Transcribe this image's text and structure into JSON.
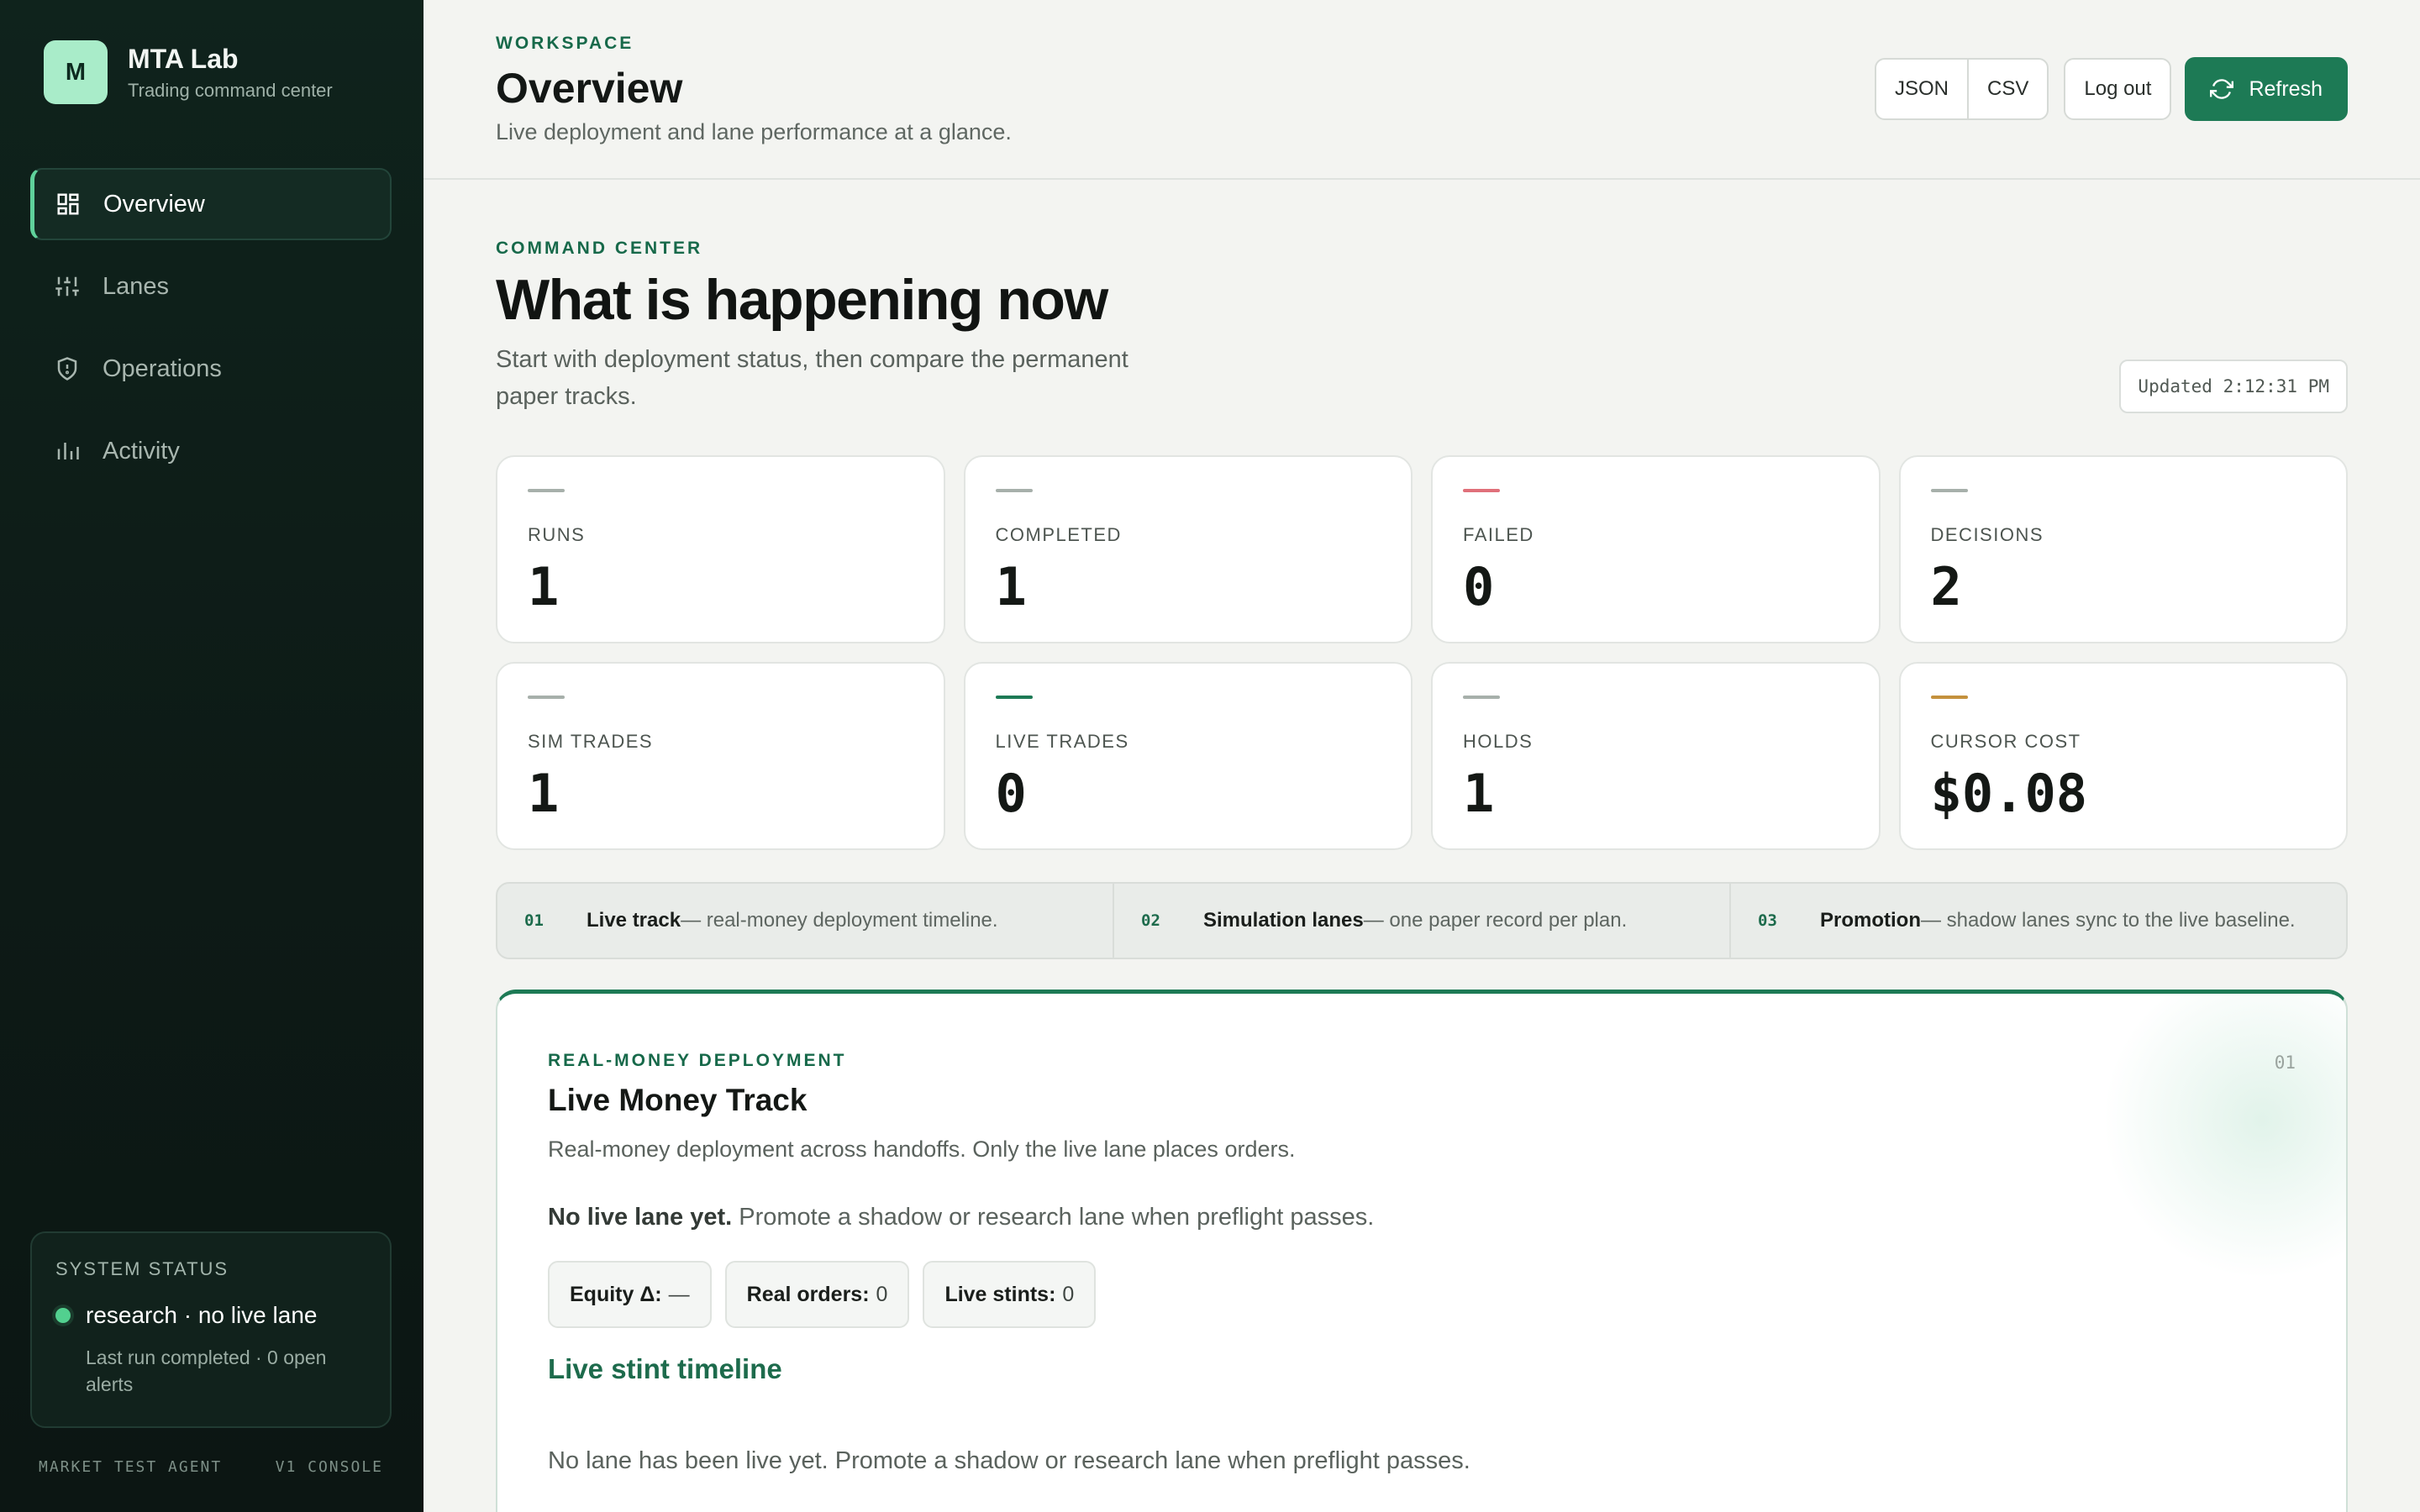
{
  "sidebar": {
    "brand": {
      "initial": "M",
      "name": "MTA Lab",
      "subtitle": "Trading command center"
    },
    "nav": [
      {
        "label": "Overview",
        "icon": "dashboard-icon",
        "active": true
      },
      {
        "label": "Lanes",
        "icon": "sliders-icon",
        "active": false
      },
      {
        "label": "Operations",
        "icon": "shield-icon",
        "active": false
      },
      {
        "label": "Activity",
        "icon": "bar-chart-icon",
        "active": false
      }
    ],
    "status": {
      "heading": "SYSTEM STATUS",
      "state": "research · no live lane",
      "detail": "Last run completed · 0 open alerts",
      "dot_color": "#52d08f"
    },
    "footer": {
      "left": "MARKET TEST AGENT",
      "right": "V1 CONSOLE"
    }
  },
  "header": {
    "eyebrow": "WORKSPACE",
    "title": "Overview",
    "subtitle": "Live deployment and lane performance at a glance.",
    "actions": {
      "json": "JSON",
      "csv": "CSV",
      "logout": "Log out",
      "refresh": "Refresh"
    }
  },
  "command_center": {
    "eyebrow": "COMMAND CENTER",
    "title": "What is happening now",
    "subtitle": "Start with deployment status, then compare the permanent paper tracks.",
    "updated": "Updated 2:12:31 PM"
  },
  "stats": [
    {
      "label": "RUNS",
      "value": "1",
      "accent": "#a7b0ab"
    },
    {
      "label": "COMPLETED",
      "value": "1",
      "accent": "#a7b0ab"
    },
    {
      "label": "FAILED",
      "value": "0",
      "accent": "#e0707a"
    },
    {
      "label": "DECISIONS",
      "value": "2",
      "accent": "#a7b0ab"
    },
    {
      "label": "SIM TRADES",
      "value": "1",
      "accent": "#a7b0ab"
    },
    {
      "label": "LIVE TRADES",
      "value": "0",
      "accent": "#1d7a55"
    },
    {
      "label": "HOLDS",
      "value": "1",
      "accent": "#a7b0ab"
    },
    {
      "label": "CURSOR COST",
      "value": "$0.08",
      "accent": "#c4913c"
    }
  ],
  "steps": [
    {
      "num": "01",
      "title": "Live track",
      "desc": " — real-money deployment timeline."
    },
    {
      "num": "02",
      "title": "Simulation lanes",
      "desc": " — one paper record per plan."
    },
    {
      "num": "03",
      "title": "Promotion",
      "desc": " — shadow lanes sync to the live baseline."
    }
  ],
  "live_card": {
    "eyebrow": "REAL-MONEY DEPLOYMENT",
    "number": "01",
    "title": "Live Money Track",
    "subtitle": "Real-money deployment across handoffs. Only the live lane places orders.",
    "message_bold": "No live lane yet.",
    "message_rest": " Promote a shadow or research lane when preflight passes.",
    "chips": [
      {
        "label": "Equity Δ:",
        "value": "—"
      },
      {
        "label": "Real orders:",
        "value": "0"
      },
      {
        "label": "Live stints:",
        "value": "0"
      }
    ],
    "timeline_title": "Live stint timeline",
    "empty_message": "No lane has been live yet. Promote a shadow or research lane when preflight passes."
  },
  "colors": {
    "accent": "#1d7a55",
    "sidebar_bg": "#0f231c",
    "page_bg": "#f3f4f1"
  }
}
